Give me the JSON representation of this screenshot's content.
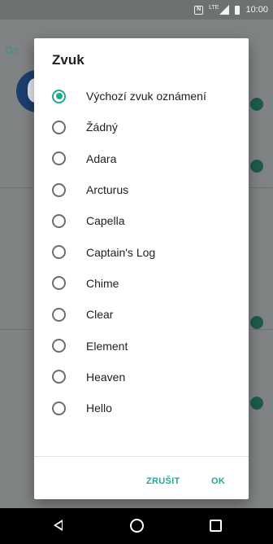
{
  "status_bar": {
    "nfc_icon": "nfc-icon",
    "network": "LTE",
    "time": "10:00"
  },
  "background": {
    "title": "Oz"
  },
  "dialog": {
    "title": "Zvuk",
    "options": [
      {
        "label": "Výchozí zvuk oznámení",
        "checked": true
      },
      {
        "label": "Žádný",
        "checked": false
      },
      {
        "label": "Adara",
        "checked": false
      },
      {
        "label": "Arcturus",
        "checked": false
      },
      {
        "label": "Capella",
        "checked": false
      },
      {
        "label": "Captain's Log",
        "checked": false
      },
      {
        "label": "Chime",
        "checked": false
      },
      {
        "label": "Clear",
        "checked": false
      },
      {
        "label": "Element",
        "checked": false
      },
      {
        "label": "Heaven",
        "checked": false
      },
      {
        "label": "Hello",
        "checked": false
      }
    ],
    "cancel_label": "ZRUŠIT",
    "ok_label": "OK"
  },
  "colors": {
    "accent": "#1ea897",
    "scrim": "#7f8384"
  },
  "nav_bar": {
    "back_icon": "back-icon",
    "home_icon": "home-icon",
    "recents_icon": "recents-icon"
  }
}
